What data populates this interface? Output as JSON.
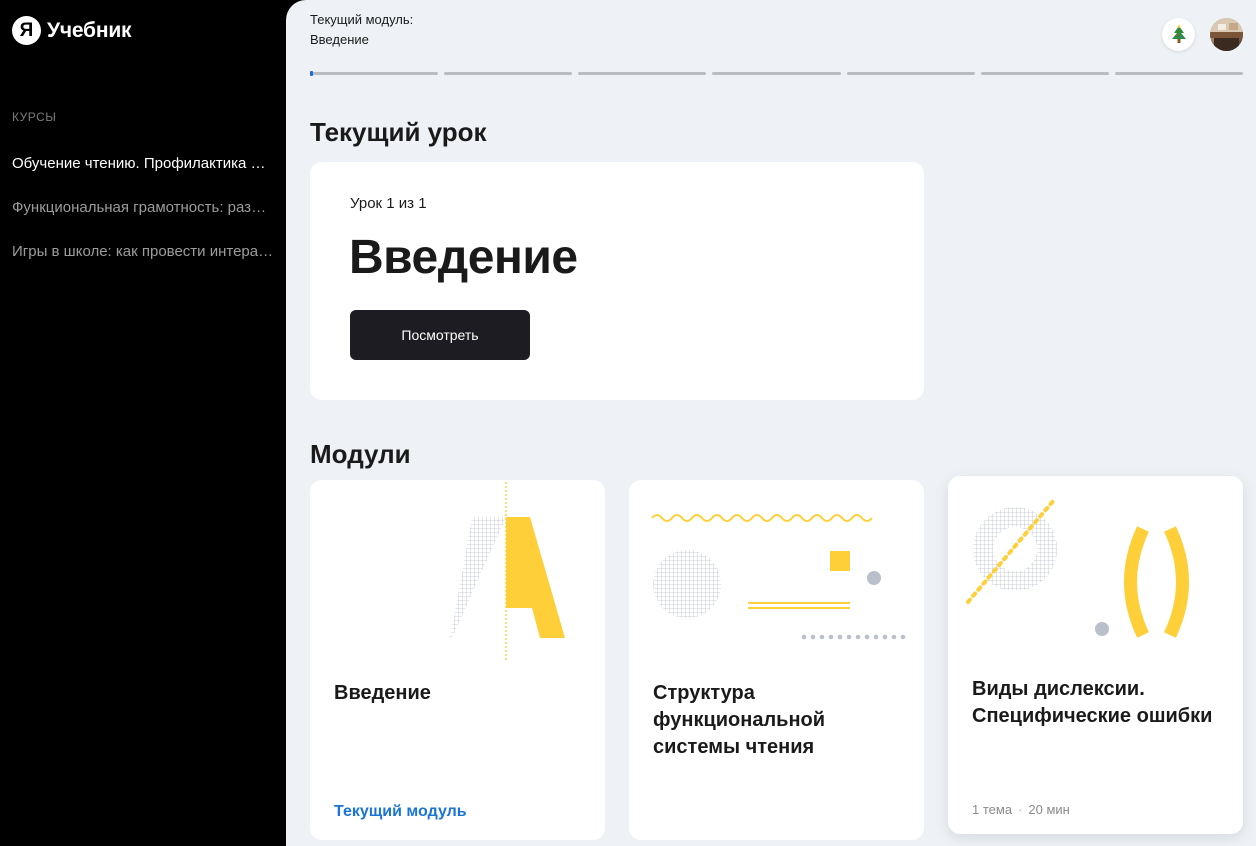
{
  "app": {
    "logo_letter": "Я",
    "logo_text": "Учебник"
  },
  "sidebar": {
    "caption": "КУРСЫ",
    "courses": [
      {
        "label": "Обучение чтению. Профилактика дислексии"
      },
      {
        "label": "Функциональная грамотность: развитие"
      },
      {
        "label": "Игры в школе: как провести интерактивный урок"
      }
    ]
  },
  "header": {
    "current_module_caption": "Текущий модуль:",
    "current_module_name": "Введение",
    "progress": {
      "segments": 7,
      "current_segment": 1,
      "current_fill": 0.02
    },
    "tree_icon": "christmas-tree-icon",
    "avatar_icon": "avatar"
  },
  "current_lesson": {
    "heading": "Текущий урок",
    "counter": "Урок 1 из 1",
    "title": "Введение",
    "button_label": "Посмотреть"
  },
  "modules": {
    "heading": "Модули",
    "items": [
      {
        "title": "Введение",
        "status": "Текущий модуль"
      },
      {
        "title": "Структура функциональной системы чтения"
      },
      {
        "title": "Виды дислексии. Специфические ошибки",
        "topics": "1 тема",
        "duration": "20 мин"
      }
    ]
  },
  "colors": {
    "accent_blue": "#1a74d6",
    "art_yellow": "#ffcf3a",
    "art_grey": "#b9c0cb",
    "dark_button": "#1c1c22"
  }
}
